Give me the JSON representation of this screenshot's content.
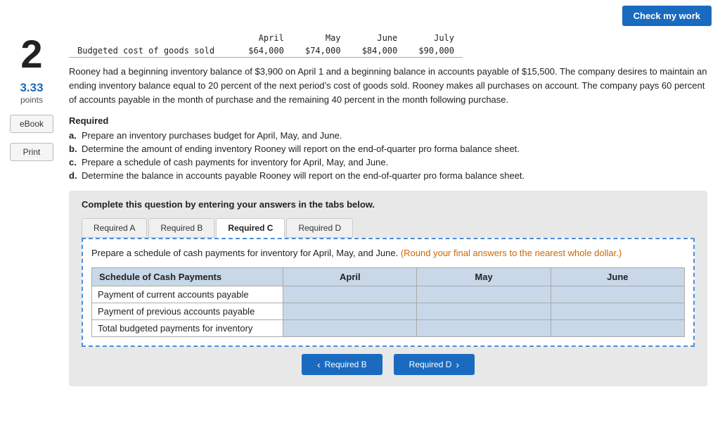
{
  "header": {
    "check_my_work_label": "Check my work"
  },
  "question": {
    "number": "2",
    "points": "3.33",
    "points_label": "points"
  },
  "sidebar": {
    "ebook_label": "eBook",
    "print_label": "Print"
  },
  "budget_table": {
    "columns": [
      "April",
      "May",
      "June",
      "July"
    ],
    "row_label": "Budgeted cost of goods sold",
    "values": [
      "$64,000",
      "$74,000",
      "$84,000",
      "$90,000"
    ]
  },
  "problem_text": "Rooney had a beginning inventory balance of $3,900 on April 1 and a beginning balance in accounts payable of $15,500. The company desires to maintain an ending inventory balance equal to 20 percent of the next period’s cost of goods sold. Rooney makes all purchases on account. The company pays 60 percent of accounts payable in the month of purchase and the remaining 40 percent in the month following purchase.",
  "required": {
    "heading": "Required",
    "items": [
      {
        "letter": "a.",
        "text": "Prepare an inventory purchases budget for April, May, and June."
      },
      {
        "letter": "b.",
        "text": "Determine the amount of ending inventory Rooney will report on the end-of-quarter pro forma balance sheet."
      },
      {
        "letter": "c.",
        "text": "Prepare a schedule of cash payments for inventory for April, May, and June."
      },
      {
        "letter": "d.",
        "text": "Determine the balance in accounts payable Rooney will report on the end-of-quarter pro forma balance sheet."
      }
    ]
  },
  "complete_box": {
    "text": "Complete this question by entering your answers in the tabs below."
  },
  "tabs": [
    {
      "id": "required-a",
      "label": "Required A"
    },
    {
      "id": "required-b",
      "label": "Required B"
    },
    {
      "id": "required-c",
      "label": "Required C",
      "active": true
    },
    {
      "id": "required-d",
      "label": "Required D"
    }
  ],
  "tab_c": {
    "instruction": "Prepare a schedule of cash payments for inventory for April, May, and June.",
    "instruction_note": "(Round your final answers to the nearest whole dollar.)",
    "table": {
      "headers": [
        "Schedule of Cash Payments",
        "April",
        "May",
        "June"
      ],
      "rows": [
        {
          "label": "Payment of current accounts payable",
          "april": "",
          "may": "",
          "june": ""
        },
        {
          "label": "Payment of previous accounts payable",
          "april": "",
          "may": "",
          "june": ""
        },
        {
          "label": "Total budgeted payments for inventory",
          "april": "",
          "may": "",
          "june": ""
        }
      ]
    }
  },
  "nav_buttons": {
    "prev_label": "Required B",
    "next_label": "Required D"
  }
}
